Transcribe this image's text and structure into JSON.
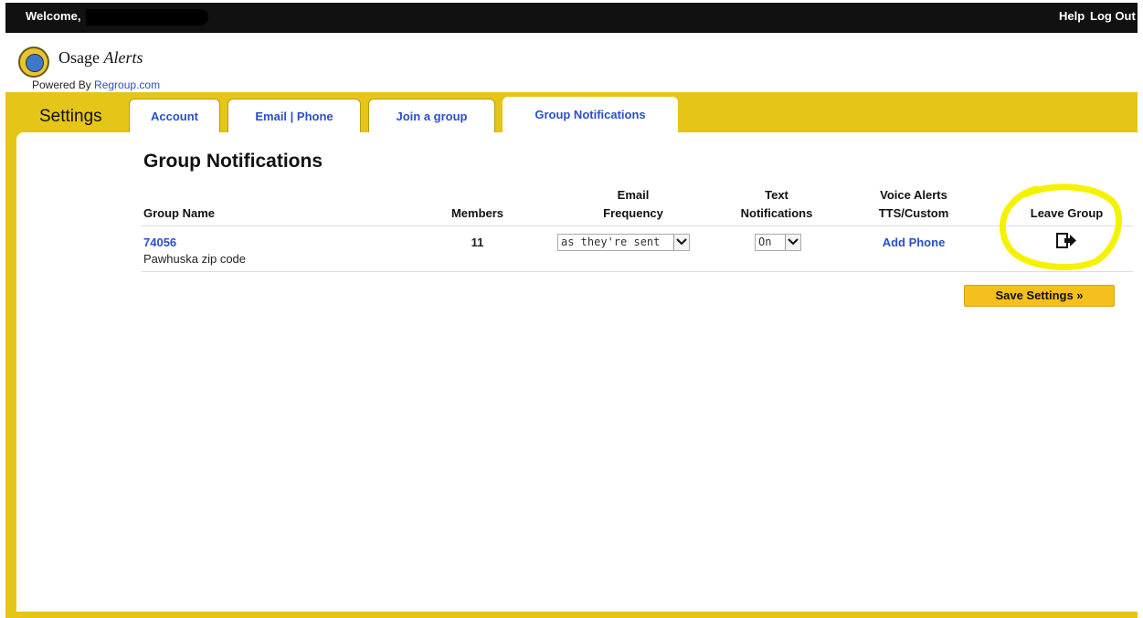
{
  "topbar": {
    "welcome": "Welcome,",
    "help": "Help",
    "logout": "Log Out"
  },
  "brand": {
    "name": "Osage",
    "name_italic": "Alerts",
    "powered_by": "Powered By",
    "powered_link": "Regroup.com"
  },
  "nav": {
    "section": "Settings",
    "tabs": [
      "Account",
      "Email | Phone",
      "Join a group",
      "Group Notifications"
    ],
    "active_tab": "Group Notifications"
  },
  "main": {
    "title": "Group Notifications",
    "columns": {
      "group_name": "Group Name",
      "members": "Members",
      "email_frequency_1": "Email",
      "email_frequency_2": "Frequency",
      "text_notifications_1": "Text",
      "text_notifications_2": "Notifications",
      "voice_alerts_1": "Voice Alerts",
      "voice_alerts_2": "TTS/Custom",
      "leave_group": "Leave Group"
    },
    "rows": [
      {
        "group_id": "74056",
        "description": "Pawhuska zip code",
        "members": "11",
        "email_frequency": "as they're sent",
        "text_notifications": "On",
        "voice_alerts": "Add Phone"
      }
    ],
    "save_button": "Save Settings »"
  },
  "colors": {
    "frame": "#e6c519",
    "link": "#2a4fc9",
    "highlight": "#f5f200",
    "save_button": "#f5c01d"
  },
  "icons": {
    "leave_group": "exit-icon",
    "logo": "osage-seal-logo"
  }
}
